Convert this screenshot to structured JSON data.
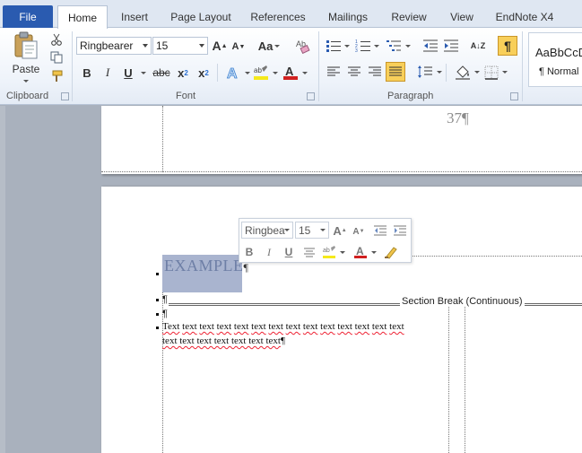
{
  "tabs": {
    "file": "File",
    "home": "Home",
    "insert": "Insert",
    "page_layout": "Page Layout",
    "references": "References",
    "mailings": "Mailings",
    "review": "Review",
    "view": "View",
    "endnote": "EndNote X4"
  },
  "clipboard": {
    "paste_label": "Paste",
    "group_label": "Clipboard"
  },
  "font": {
    "font_name": "Ringbearer",
    "font_size": "15",
    "grow_glyph": "A",
    "shrink_glyph": "A",
    "change_case_glyph": "Aa",
    "bold": "B",
    "italic": "I",
    "underline": "U",
    "strike": "abc",
    "subscript": "x",
    "subscript_sub": "2",
    "superscript": "x",
    "superscript_sup": "2",
    "font_color_glyph": "A",
    "group_label": "Font"
  },
  "paragraph": {
    "group_label": "Paragraph",
    "show_hide_glyph": "¶",
    "sort_glyph": "A↓Z"
  },
  "styles": {
    "preview": "AaBbCcD",
    "normal_label": "¶ Normal"
  },
  "document": {
    "page_number": "37¶",
    "heading_text": "EXAMPLE",
    "heading_mark": "¶",
    "section_break_label": "Section Break (Continuous)",
    "empty_para_1": "¶",
    "empty_para_2": "¶",
    "body_words_line1": [
      "Text",
      "text",
      "text",
      "text",
      "text",
      "text",
      "text",
      "text",
      "text",
      "text",
      "text",
      "text",
      "text",
      "text"
    ],
    "body_line2": "text text text text text text text",
    "body_end_mark": "¶"
  },
  "minitoolbar": {
    "font_name": "Ringbea",
    "font_size": "15",
    "grow_glyph": "A",
    "shrink_glyph": "A",
    "bold": "B",
    "italic": "I",
    "underline": "U",
    "font_color_glyph": "A"
  },
  "colors": {
    "file_tab": "#2a5bb0",
    "highlight_yellow": "#f5e91b",
    "font_color_red": "#d02020",
    "selection": "#9aa6c4",
    "active_toggle": "#f8cf5a"
  }
}
